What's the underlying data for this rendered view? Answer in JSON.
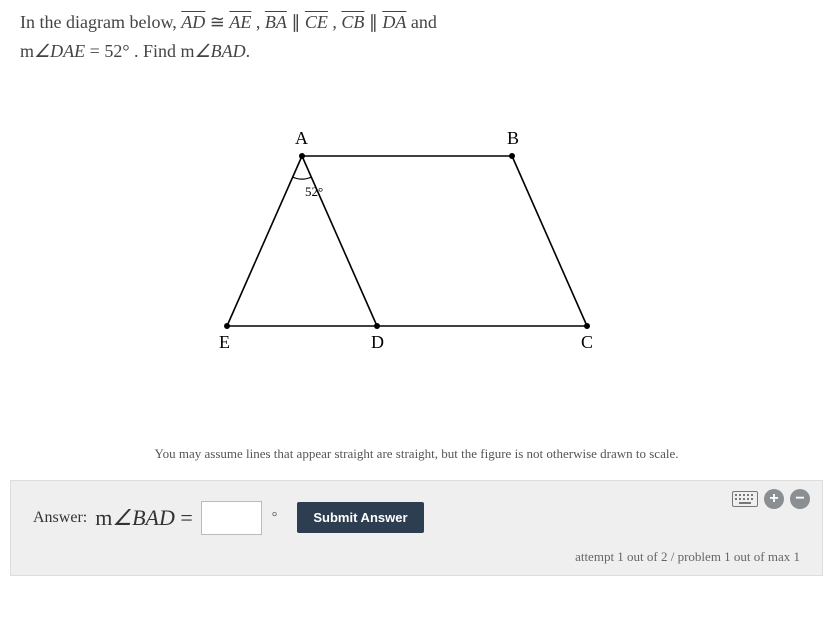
{
  "problem": {
    "line1_pre": "In the diagram below,  ",
    "seg1": "AD",
    "cong": " ≅ ",
    "seg2": "AE",
    "sep1": ",  ",
    "seg3": "BA",
    "parallel": " ∥ ",
    "seg4": "CE",
    "sep2": ",  ",
    "seg5": "CB",
    "seg6": "DA",
    "and": " and",
    "line2_pre": "m",
    "angle1": "∠DAE",
    "eq": " = ",
    "value": "52°",
    "find": ". Find m",
    "angle2": "∠BAD",
    "dot": "."
  },
  "diagram": {
    "labels": {
      "A": "A",
      "B": "B",
      "C": "C",
      "D": "D",
      "E": "E"
    },
    "angle_label": "52°"
  },
  "note": "You may assume lines that appear straight are straight, but the figure is not otherwise drawn to scale.",
  "answer": {
    "label": "Answer:  ",
    "expr_m": "m",
    "expr_angle": "∠BAD",
    "expr_eq": " = ",
    "input_value": "",
    "degree": "°",
    "submit": "Submit Answer"
  },
  "status": "attempt 1 out of 2 / problem 1 out of max 1"
}
